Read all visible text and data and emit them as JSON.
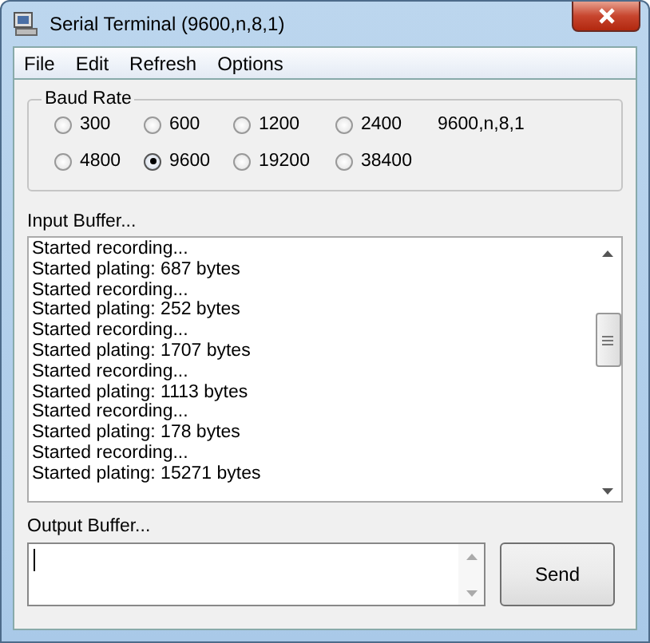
{
  "window": {
    "title": "Serial Terminal (9600,n,8,1)"
  },
  "menu": [
    "File",
    "Edit",
    "Refresh",
    "Options"
  ],
  "baud_rate": {
    "title": "Baud Rate",
    "setting": "9600,n,8,1",
    "options": [
      {
        "label": "300",
        "selected": false
      },
      {
        "label": "600",
        "selected": false
      },
      {
        "label": "1200",
        "selected": false
      },
      {
        "label": "2400",
        "selected": false
      },
      {
        "label": "4800",
        "selected": false
      },
      {
        "label": "9600",
        "selected": true
      },
      {
        "label": "19200",
        "selected": false
      },
      {
        "label": "38400",
        "selected": false
      }
    ]
  },
  "input_buffer": {
    "label": "Input Buffer...",
    "lines": [
      "Started recording...",
      "Started plating: 687 bytes",
      "Started recording...",
      "Started plating: 252 bytes",
      "Started recording...",
      "Started plating: 1707 bytes",
      "Started recording...",
      "Started plating: 1113 bytes",
      "Started recording...",
      "Started plating: 178 bytes",
      "Started recording...",
      "Started plating: 15271 bytes"
    ]
  },
  "output_buffer": {
    "label": "Output Buffer..."
  },
  "buttons": [
    "Send"
  ]
}
